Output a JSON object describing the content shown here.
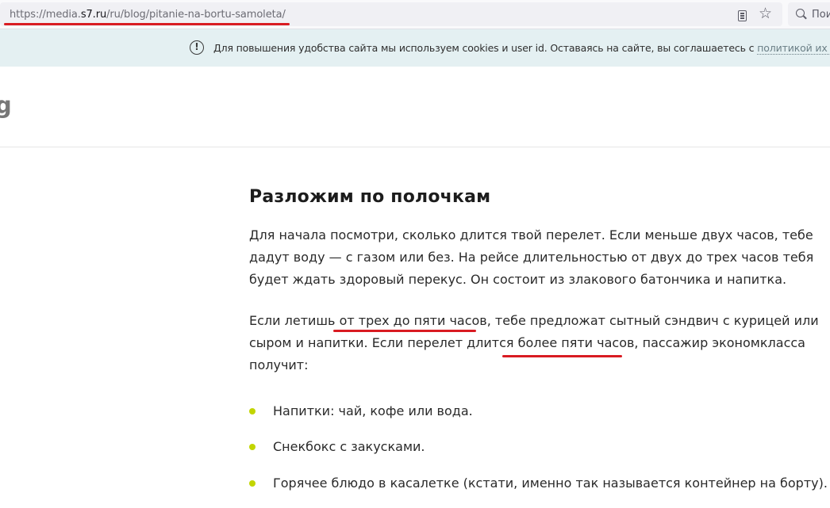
{
  "browser": {
    "url_prefix": "https://media.",
    "url_host": "s7.ru",
    "url_path": "/ru/blog/pitanie-na-bortu-samoleta/",
    "search_text": "Пои"
  },
  "cookie_banner": {
    "text": "Для повышения удобства сайта мы используем cookies и user id. Оставаясь на сайте, вы соглашаетесь с",
    "link": "политикой их примене"
  },
  "site": {
    "logo_fragment": "g"
  },
  "article": {
    "heading": "Разложим по полочкам",
    "para1": [
      "Для начала посмотри, сколько длится твой перелет. Если меньше двух часов, тебе",
      "дадут воду — с газом или без. На рейсе длительностью от двух до трех часов тебя",
      "будет ждать здоровый перекус. Он состоит из злакового батончика и напитка."
    ],
    "para2": [
      "Если летишь от трех до пяти часов, тебе предложат сытный сэндвич с курицей или",
      "сыром и напитки. Если перелет длится более пяти часов, пассажир экономкласса",
      "получит:"
    ],
    "bullets": [
      "Напитки: чай, кофе или вода.",
      "Снекбокс с закусками.",
      "Горячее блюдо в касалетке (кстати, именно так называется контейнер на борту)."
    ]
  },
  "colors": {
    "annotation_red": "#d91b22",
    "bullet_accent": "#c2d500",
    "cookie_bg": "#e4f0f2"
  }
}
